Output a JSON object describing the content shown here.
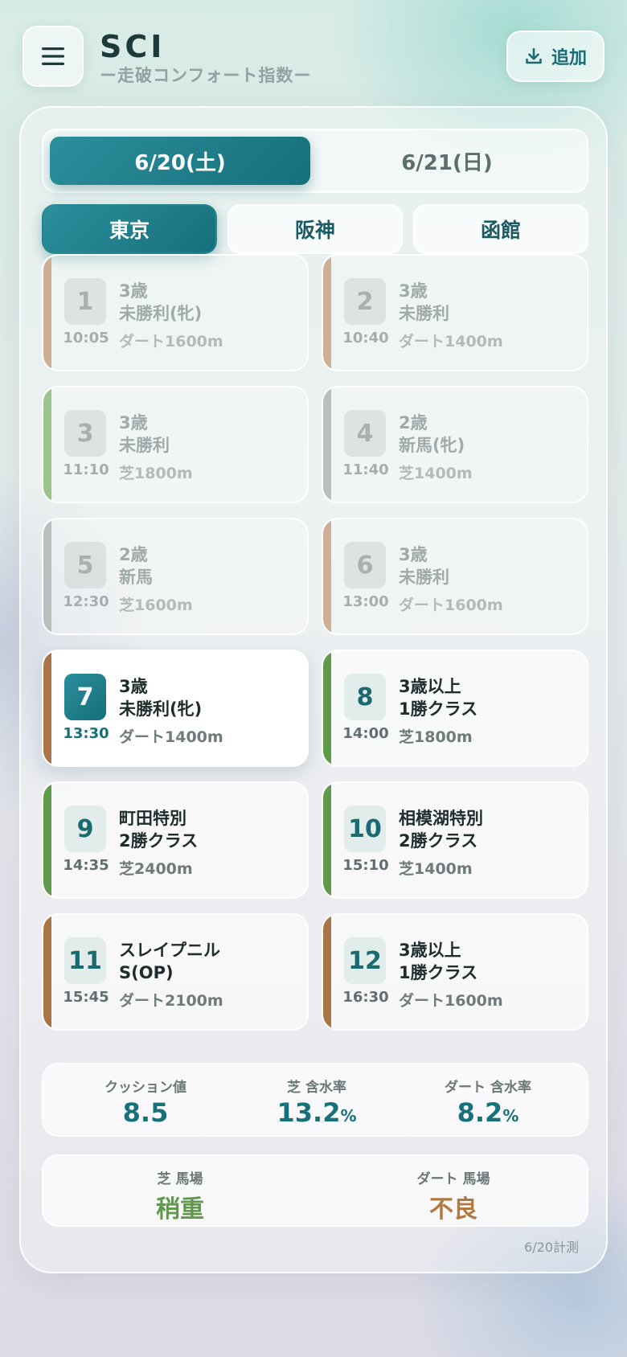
{
  "header": {
    "title": "SCI",
    "subtitle": "ー走破コンフォート指数ー",
    "add_label": "追加"
  },
  "date_tabs": [
    {
      "label": "6/20(土)",
      "active": true
    },
    {
      "label": "6/21(日)",
      "active": false
    }
  ],
  "venues": [
    {
      "label": "東京",
      "active": true
    },
    {
      "label": "阪神",
      "active": false
    },
    {
      "label": "函館",
      "active": false
    }
  ],
  "races": [
    {
      "num": "1",
      "time": "10:05",
      "line1": "3歳",
      "line2": "未勝利(牝)",
      "course": "ダート1600m",
      "surface": "dirt",
      "state": "past"
    },
    {
      "num": "2",
      "time": "10:40",
      "line1": "3歳",
      "line2": "未勝利",
      "course": "ダート1400m",
      "surface": "dirt",
      "state": "past"
    },
    {
      "num": "3",
      "time": "11:10",
      "line1": "3歳",
      "line2": "未勝利",
      "course": "芝1800m",
      "surface": "turf",
      "state": "past"
    },
    {
      "num": "4",
      "time": "11:40",
      "line1": "2歳",
      "line2": "新馬(牝)",
      "course": "芝1400m",
      "surface": "newcomer",
      "state": "past"
    },
    {
      "num": "5",
      "time": "12:30",
      "line1": "2歳",
      "line2": "新馬",
      "course": "芝1600m",
      "surface": "newcomer",
      "state": "past"
    },
    {
      "num": "6",
      "time": "13:00",
      "line1": "3歳",
      "line2": "未勝利",
      "course": "ダート1600m",
      "surface": "dirt",
      "state": "past"
    },
    {
      "num": "7",
      "time": "13:30",
      "line1": "3歳",
      "line2": "未勝利(牝)",
      "course": "ダート1400m",
      "surface": "dirt",
      "state": "current"
    },
    {
      "num": "8",
      "time": "14:00",
      "line1": "3歳以上",
      "line2": "1勝クラス",
      "course": "芝1800m",
      "surface": "turf",
      "state": "upcoming"
    },
    {
      "num": "9",
      "time": "14:35",
      "line1": "町田特別",
      "line2": "2勝クラス",
      "course": "芝2400m",
      "surface": "turf",
      "state": "upcoming"
    },
    {
      "num": "10",
      "time": "15:10",
      "line1": "相模湖特別",
      "line2": "2勝クラス",
      "course": "芝1400m",
      "surface": "turf",
      "state": "upcoming"
    },
    {
      "num": "11",
      "time": "15:45",
      "line1": "スレイプニル",
      "line2": "S(OP)",
      "course": "ダート2100m",
      "surface": "dirt",
      "state": "upcoming"
    },
    {
      "num": "12",
      "time": "16:30",
      "line1": "3歳以上",
      "line2": "1勝クラス",
      "course": "ダート1600m",
      "surface": "dirt",
      "state": "upcoming"
    }
  ],
  "stats": {
    "cushion": {
      "label": "クッション値",
      "value": "8.5",
      "unit": ""
    },
    "turf_moisture": {
      "label": "芝 含水率",
      "value": "13.2",
      "unit": "%"
    },
    "dirt_moisture": {
      "label": "ダート 含水率",
      "value": "8.2",
      "unit": "%"
    }
  },
  "track": {
    "turf": {
      "label": "芝 馬場",
      "value": "稍重",
      "color": "#5e9a4a"
    },
    "dirt": {
      "label": "ダート 馬場",
      "value": "不良",
      "color": "#b07a42"
    }
  },
  "measured_note": "6/20計測",
  "colors": {
    "accent": "#17707a",
    "turf_stripe": "#5e9a4a",
    "dirt_stripe": "#a97446",
    "newcomer_stripe": "#b9bfbc",
    "turf_stripe_past": "#9cc28e",
    "dirt_stripe_past": "#cfae96"
  }
}
